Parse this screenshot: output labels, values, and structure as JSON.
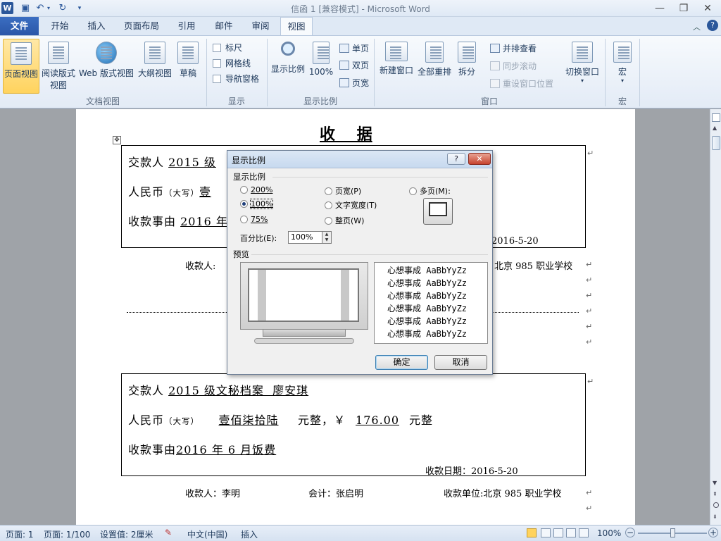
{
  "window": {
    "title": "信函 1 [兼容模式] - Microsoft Word"
  },
  "tabs": [
    "文件",
    "开始",
    "插入",
    "页面布局",
    "引用",
    "邮件",
    "审阅",
    "视图"
  ],
  "ribbon": {
    "document_views": {
      "group_label": "文档视图",
      "buttons": [
        "页面视图",
        "阅读版式\n视图",
        "Web 版式视图",
        "大纲视图",
        "草稿"
      ]
    },
    "show": {
      "group_label": "显示",
      "ruler": "标尺",
      "gridlines": "网格线",
      "nav_pane": "导航窗格"
    },
    "zoom": {
      "group_label": "显示比例",
      "zoom": "显示比例",
      "hundred": "100%",
      "one_page": "单页",
      "two_pages": "双页",
      "page_width": "页宽"
    },
    "window": {
      "group_label": "窗口",
      "new_window": "新建窗口",
      "arrange_all": "全部重排",
      "split": "拆分",
      "side_by_side": "并排查看",
      "sync_scroll": "同步滚动",
      "reset_pos": "重设窗口位置",
      "switch": "切换窗口"
    },
    "macros": {
      "group_label": "宏",
      "macros": "宏"
    }
  },
  "document": {
    "heading": "收    据",
    "receipt_top": {
      "payer_label": "交款人",
      "payer_value": "2015 级",
      "rmb_label": "人民币",
      "rmb_note": "（大写）",
      "rmb_value": "壹",
      "reason_label": "收款事由",
      "reason_value": "2016 年",
      "date": "2016-5-20",
      "collector": "收款人:",
      "unit": "北京 985 职业学校"
    },
    "receipt_bottom": {
      "payer_label": "交款人",
      "payer_value": "2015 级文秘档案  廖安琪",
      "rmb_label": "人民币",
      "rmb_note": "（大写）",
      "rmb_value": "壹佰柒拾陆",
      "rmb_suffix1": "元整，￥",
      "amount": "176.00",
      "rmb_suffix2": "元整",
      "reason_label": "收款事由",
      "reason_value": "2016 年 6 月饭费",
      "date": "收款日期：2016-5-20",
      "collector": "收款人：李明",
      "accountant": "会计：张启明",
      "unit": "收款单位:北京 985 职业学校"
    }
  },
  "status_bar": {
    "page": "页面: 1",
    "pages": "页面: 1/100",
    "setting": "设置值: 2厘米",
    "language": "中文(中国)",
    "mode": "插入",
    "zoom": "100%"
  },
  "dialog": {
    "title": "显示比例",
    "help": "?",
    "section_zoom": "显示比例",
    "options": {
      "p200": "200%",
      "p100": "100%",
      "p75": "75%",
      "page_width": "页宽(P)",
      "text_width": "文字宽度(T)",
      "whole_page": "整页(W)",
      "many_pages": "多页(M):"
    },
    "selected": "100%",
    "percent_label": "百分比(E):",
    "percent_value": "100%",
    "section_preview": "预览",
    "sample_lines": [
      "心想事成 AaBbYyZz",
      "心想事成 AaBbYyZz",
      "心想事成 AaBbYyZz",
      "心想事成 AaBbYyZz",
      "心想事成 AaBbYyZz",
      "心想事成 AaBbYyZz"
    ],
    "ok": "确定",
    "cancel": "取消"
  }
}
